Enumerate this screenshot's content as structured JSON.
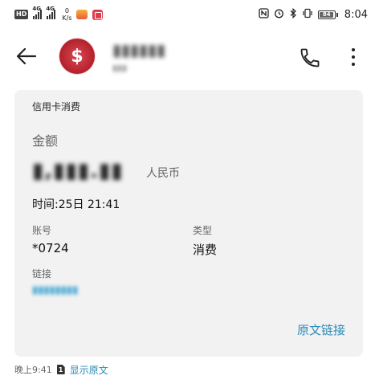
{
  "status_bar": {
    "hd": "HD",
    "signal_1_tag": "4G",
    "signal_2_tag": "4G",
    "net_speed_value": "0",
    "net_speed_unit": "K/s",
    "icons": [
      "nfc-icon",
      "alarm-icon",
      "bluetooth-icon",
      "vibrate-icon"
    ],
    "battery_level": "84",
    "battery_fraction": 0.84,
    "time": "8:04"
  },
  "header": {
    "contact_name": "▮▮▮▮▮▮",
    "contact_sub": "▮▮▮",
    "avatar_glyph": "$"
  },
  "card": {
    "title": "信用卡消费",
    "amount_label": "金额",
    "amount_value": "▮,▮▮▮.▮▮",
    "amount_unit": "人民币",
    "time_text": "时间:25日 21:41",
    "account_label": "账号",
    "account_value": "*0724",
    "type_label": "类型",
    "type_value": "消费",
    "link_label": "链接",
    "link_value": "▮▮▮▮▮▮▮▮",
    "original_link": "原文链接"
  },
  "meta": {
    "timestamp": "晚上9:41",
    "sim": "1",
    "show_original": "显示原文"
  }
}
